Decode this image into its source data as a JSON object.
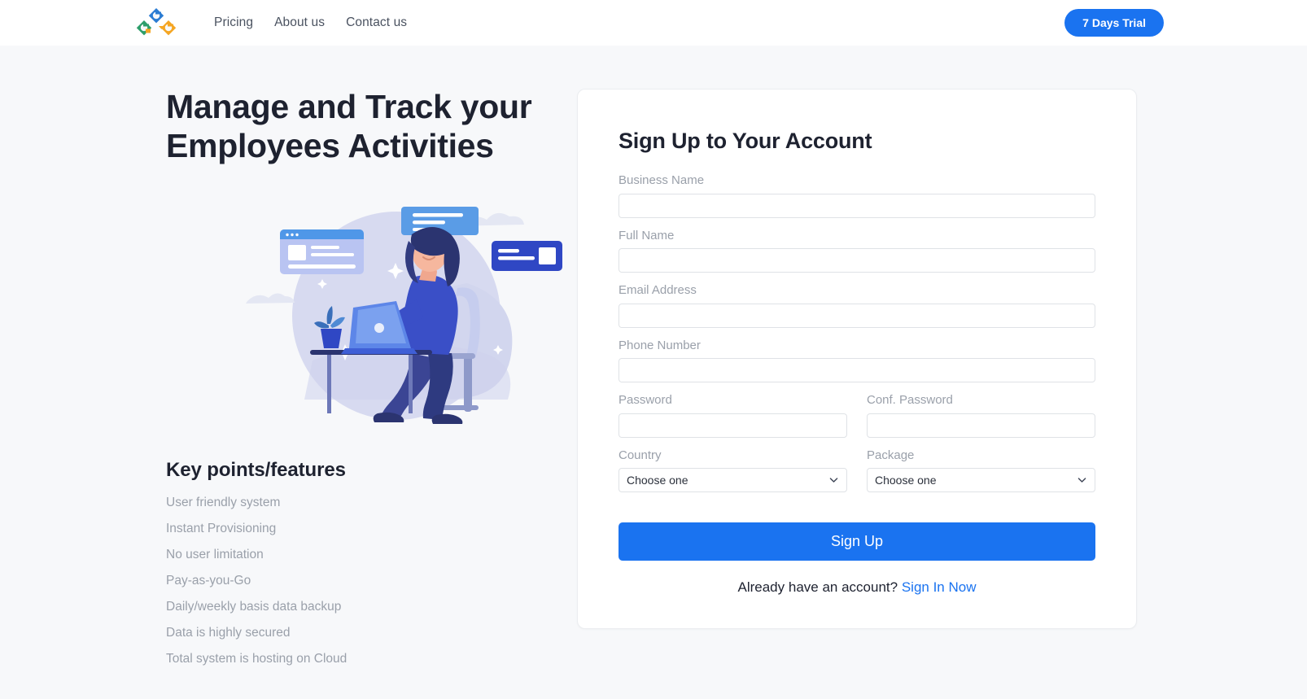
{
  "navbar": {
    "logo_name": "company-logo",
    "links": [
      {
        "label": "Pricing"
      },
      {
        "label": "About us"
      },
      {
        "label": "Contact us"
      }
    ],
    "trial_button": "7 Days Trial"
  },
  "hero": {
    "title_line1": "Manage and Track your",
    "title_line2": "Employees Activities",
    "illustration_name": "woman-working-on-laptop-illustration"
  },
  "features": {
    "heading": "Key points/features",
    "items": [
      {
        "label": "User friendly system"
      },
      {
        "label": "Instant Provisioning"
      },
      {
        "label": "No user limitation"
      },
      {
        "label": "Pay-as-you-Go"
      },
      {
        "label": "Daily/weekly basis data backup"
      },
      {
        "label": "Data is highly secured"
      },
      {
        "label": "Total system is hosting on Cloud"
      }
    ]
  },
  "signup": {
    "title": "Sign Up to Your Account",
    "fields": {
      "business_name": {
        "label": "Business Name",
        "value": "",
        "placeholder": ""
      },
      "full_name": {
        "label": "Full Name",
        "value": "",
        "placeholder": ""
      },
      "email": {
        "label": "Email Address",
        "value": "",
        "placeholder": ""
      },
      "phone": {
        "label": "Phone Number",
        "value": "",
        "placeholder": ""
      },
      "password": {
        "label": "Password",
        "value": "",
        "placeholder": ""
      },
      "conf_password": {
        "label": "Conf. Password",
        "value": "",
        "placeholder": ""
      },
      "country": {
        "label": "Country",
        "selected": "Choose one",
        "options": [
          "Choose one"
        ]
      },
      "package": {
        "label": "Package",
        "selected": "Choose one",
        "options": [
          "Choose one"
        ]
      }
    },
    "submit_label": "Sign Up",
    "signin_prompt": "Already have an account?",
    "signin_link": "Sign In Now"
  },
  "colors": {
    "accent_blue": "#1a73f0",
    "page_bg": "#f7f8fa",
    "card_bg": "#ffffff",
    "heading_text": "#1e2230",
    "muted_text": "#9aa0aa",
    "border": "#dfe2e6",
    "logo_blue": "#2b7cd3",
    "logo_green": "#2e9e6b",
    "logo_orange": "#f5a623"
  }
}
